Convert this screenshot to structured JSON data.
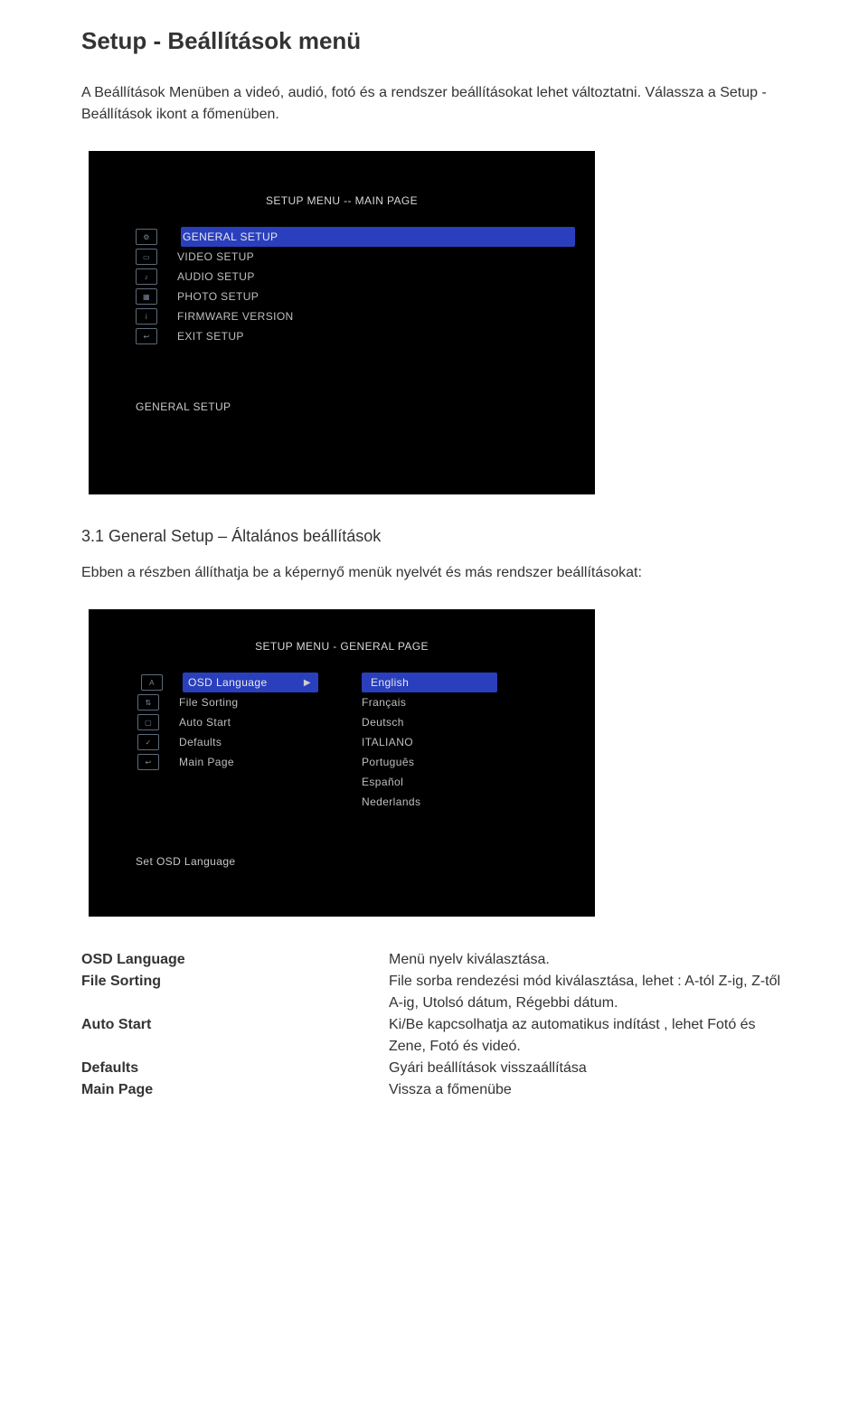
{
  "heading": "Setup - Beállítások menü",
  "intro": "A Beállítások Menüben a videó, audió, fotó és a rendszer beállításokat lehet változtatni. Válassza a Setup - Beállítások ikont a főmenüben.",
  "osd1": {
    "title": "SETUP MENU -- MAIN PAGE",
    "items": [
      {
        "label": "GENERAL SETUP",
        "selected": true
      },
      {
        "label": "VIDEO SETUP"
      },
      {
        "label": "AUDIO SETUP"
      },
      {
        "label": "PHOTO SETUP"
      },
      {
        "label": "FIRMWARE VERSION"
      },
      {
        "label": "EXIT SETUP"
      }
    ],
    "footer": "GENERAL SETUP"
  },
  "subheading": "3.1 General Setup – Általános beállítások",
  "subintro": "Ebben a részben állíthatja be a képernyő menük nyelvét és más rendszer beállításokat:",
  "osd2": {
    "title": "SETUP MENU - GENERAL PAGE",
    "left": [
      {
        "label": "OSD Language",
        "selected": true,
        "arrow": true
      },
      {
        "label": "File Sorting"
      },
      {
        "label": "Auto Start"
      },
      {
        "label": "Defaults"
      },
      {
        "label": "Main Page"
      }
    ],
    "right": [
      {
        "label": "English",
        "selected": true
      },
      {
        "label": "Français"
      },
      {
        "label": "Deutsch"
      },
      {
        "label": "ITALIANO"
      },
      {
        "label": "Português"
      },
      {
        "label": "Español"
      },
      {
        "label": "Nederlands"
      }
    ],
    "footer": "Set OSD Language"
  },
  "defs": [
    {
      "term": "OSD Language",
      "desc": "Menü nyelv kiválasztása."
    },
    {
      "term": "File Sorting",
      "desc": "File sorba rendezési mód kiválasztása, lehet : A-tól Z-ig, Z-től A-ig, Utolsó dátum, Régebbi dátum."
    },
    {
      "term": "Auto Start",
      "desc": "Ki/Be kapcsolhatja az automatikus indítást , lehet Fotó és Zene, Fotó és videó."
    },
    {
      "term": "Defaults",
      "desc": "Gyári beállítások visszaállítása"
    },
    {
      "term": "Main Page",
      "desc": "Vissza a főmenübe"
    }
  ]
}
